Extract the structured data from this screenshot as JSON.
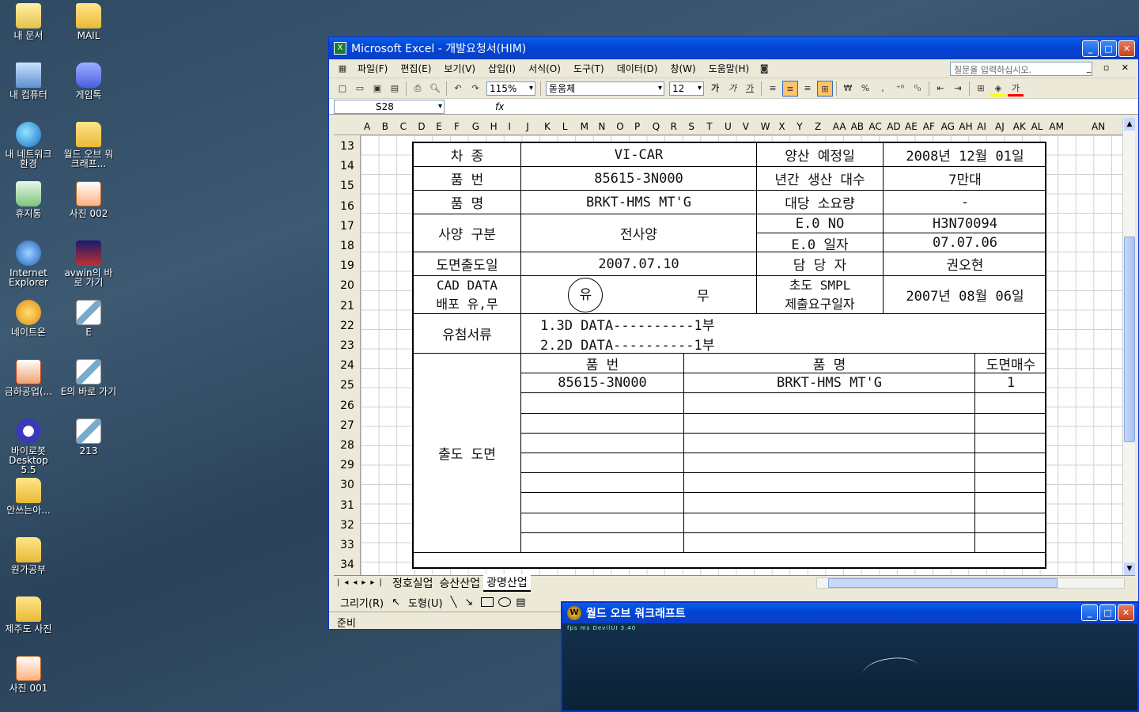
{
  "desktop_icons": [
    {
      "label": "내 문서",
      "icon": "my-documents-icon"
    },
    {
      "label": "MAIL",
      "icon": "folder-icon"
    },
    {
      "label": "내 컴퓨터",
      "icon": "my-computer-icon"
    },
    {
      "label": "게임톡",
      "icon": "chat-icon"
    },
    {
      "label": "내 네트워크 환경",
      "icon": "network-icon"
    },
    {
      "label": "월드 오브 워크래프...",
      "icon": "folder-icon"
    },
    {
      "label": "휴지통",
      "icon": "recycle-bin-icon"
    },
    {
      "label": "사진 002",
      "icon": "photo-icon"
    },
    {
      "label": "Internet Explorer",
      "icon": "ie-icon"
    },
    {
      "label": "avwin의 바로 가기",
      "icon": "avwin-icon"
    },
    {
      "label": "네이트온",
      "icon": "nateon-icon"
    },
    {
      "label": "E",
      "icon": "pen-doc-icon"
    },
    {
      "label": "금하공업(...",
      "icon": "ppt-icon"
    },
    {
      "label": "E의 바로 가기",
      "icon": "pen-doc-icon"
    },
    {
      "label": "바이로봇 Desktop 5.5",
      "icon": "virobot-icon"
    },
    {
      "label": "213",
      "icon": "pen-doc-icon"
    },
    {
      "label": "안쓰는아...",
      "icon": "folder-icon"
    },
    {
      "label": "원가공부",
      "icon": "folder-icon"
    },
    {
      "label": "제주도 사진",
      "icon": "folder-icon"
    },
    {
      "label": "사진 001",
      "icon": "photo-icon"
    }
  ],
  "excel": {
    "title": "Microsoft Excel - 개발요청서(HIM)",
    "menu": [
      "파일(F)",
      "편집(E)",
      "보기(V)",
      "삽입(I)",
      "서식(O)",
      "도구(T)",
      "데이터(D)",
      "창(W)",
      "도움말(H)"
    ],
    "ask_placeholder": "질문을 입력하십시오.",
    "zoom": "115%",
    "font_name": "돋움체",
    "font_size": "12",
    "name_box": "S28",
    "fx_label": "fx",
    "columns": [
      "A",
      "B",
      "C",
      "D",
      "E",
      "F",
      "G",
      "H",
      "I",
      "J",
      "K",
      "L",
      "M",
      "N",
      "O",
      "P",
      "Q",
      "R",
      "S",
      "T",
      "U",
      "V",
      "W",
      "X",
      "Y",
      "Z",
      "AA",
      "AB",
      "AC",
      "AD",
      "AE",
      "AF",
      "AG",
      "AH",
      "AI",
      "AJ",
      "AK",
      "AL",
      "AM",
      "AN"
    ],
    "rows": [
      "13",
      "14",
      "15",
      "16",
      "17",
      "18",
      "19",
      "20",
      "21",
      "22",
      "23",
      "24",
      "25",
      "26",
      "27",
      "28",
      "29",
      "30",
      "31",
      "32",
      "33",
      "34"
    ],
    "form": {
      "car_label": "차     종",
      "car_value": "VI-CAR",
      "mass_label": "양산 예정일",
      "mass_value": "2008년 12월 01일",
      "part_no_label": "품     번",
      "part_no_value": "85615-3N000",
      "annual_label": "년간 생산 대수",
      "annual_value": "7만대",
      "part_name_label": "품     명",
      "part_name_value": "BRKT-HMS MT'G",
      "per_car_label": "대당 소요량",
      "per_car_value": "-",
      "spec_label": "사양  구분",
      "spec_value": "전사양",
      "eo_no_label": "E.0  NO",
      "eo_no_value": "H3N70094",
      "eo_date_label": "E.0  일자",
      "eo_date_value": "07.07.06",
      "drawing_date_label": "도면출도일",
      "drawing_date_value": "2007.07.10",
      "manager_label": "담  당  자",
      "manager_value": "권오현",
      "cad_label_1": "CAD DATA",
      "cad_label_2": "배포 유,무",
      "cad_yes": "유",
      "cad_no": "무",
      "smpl_label_1": "초도 SMPL",
      "smpl_label_2": "제출요구일자",
      "smpl_value": "2007년 08월 06일",
      "attach_label": "유첨서류",
      "attach_1": "1.3D DATA----------1부",
      "attach_2": "2.2D DATA----------1부",
      "drawing_label": "출도 도면",
      "dh_part_no": "품      번",
      "dh_part_name": "품                    명",
      "dh_sheets": "도면매수",
      "d_part_no": "85615-3N000",
      "d_part_name": "BRKT-HMS MT'G",
      "d_sheets": "1"
    },
    "sheet_tabs": [
      "정호실업",
      "승산산업",
      "광명산업"
    ],
    "active_tab": "광명산업",
    "draw_label": "그리기(R)",
    "autoshape_label": "도형(U)",
    "status": "준비"
  },
  "wow": {
    "title": "월드 오브 워크래프트",
    "hud": "fps  ms  DevilUI 3.40"
  }
}
